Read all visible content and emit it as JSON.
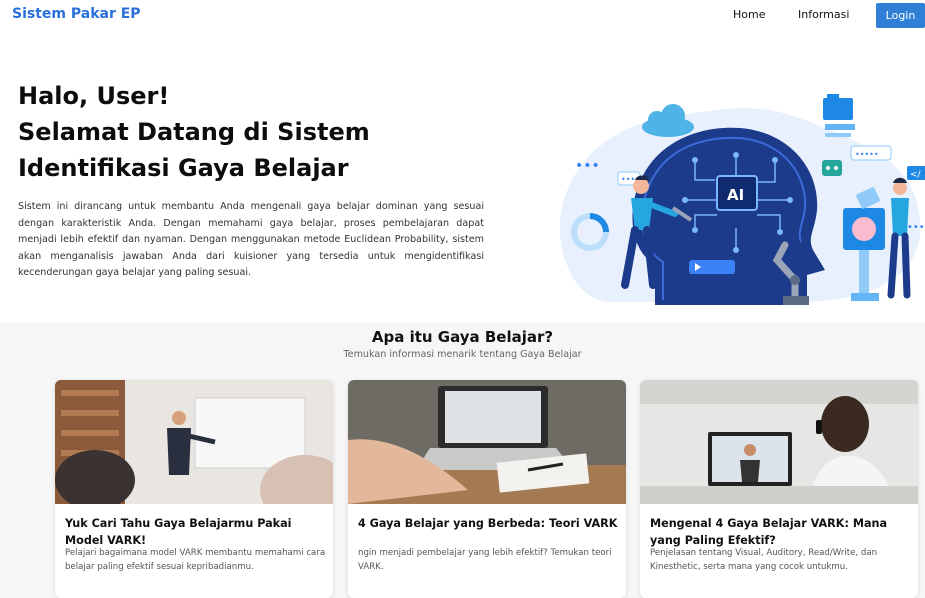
{
  "nav": {
    "brand": "Sistem Pakar EP",
    "links": [
      "Home",
      "Informasi"
    ],
    "login": "Login"
  },
  "hero": {
    "greeting": "Halo, User!",
    "title_line1": "Selamat Datang di Sistem",
    "title_line2": "Identifikasi Gaya Belajar",
    "description": "Sistem ini dirancang untuk membantu Anda mengenali gaya belajar dominan yang sesuai dengan karakteristik Anda. Dengan memahami gaya belajar, proses pembelajaran dapat menjadi lebih efektif dan nyaman. Dengan menggunakan metode Euclidean Probability, sistem akan menganalisis jawaban Anda dari kuisioner yang tersedia untuk mengidentifikasi kecenderungan gaya belajar yang paling sesuai.",
    "illustration_label": "AI",
    "illustration_icons": [
      "cloud-icon",
      "folder-icon",
      "code-icon",
      "chat-icon",
      "brain-icon",
      "robot-icon"
    ]
  },
  "section": {
    "title": "Apa itu Gaya Belajar?",
    "subtitle": "Temukan informasi menarik tentang Gaya Belajar"
  },
  "cards": [
    {
      "title": "Yuk Cari Tahu Gaya Belajarmu Pakai Model VARK!",
      "text": "Pelajari bagaimana model VARK membantu memahami cara belajar paling efektif sesuai kepribadianmu."
    },
    {
      "title": "4 Gaya Belajar yang Berbeda: Teori VARK",
      "text": "ngin menjadi pembelajar yang lebih efektif? Temukan teori VARK."
    },
    {
      "title": "Mengenal 4 Gaya Belajar VARK: Mana yang Paling Efektif?",
      "text": "Penjelasan tentang Visual, Auditory, Read/Write, dan Kinesthetic, serta mana yang cocok untukmu."
    }
  ],
  "colors": {
    "brand": "#2a6fdb",
    "login_bg": "#2f7fd6",
    "section_bg": "#f6f6f6"
  }
}
